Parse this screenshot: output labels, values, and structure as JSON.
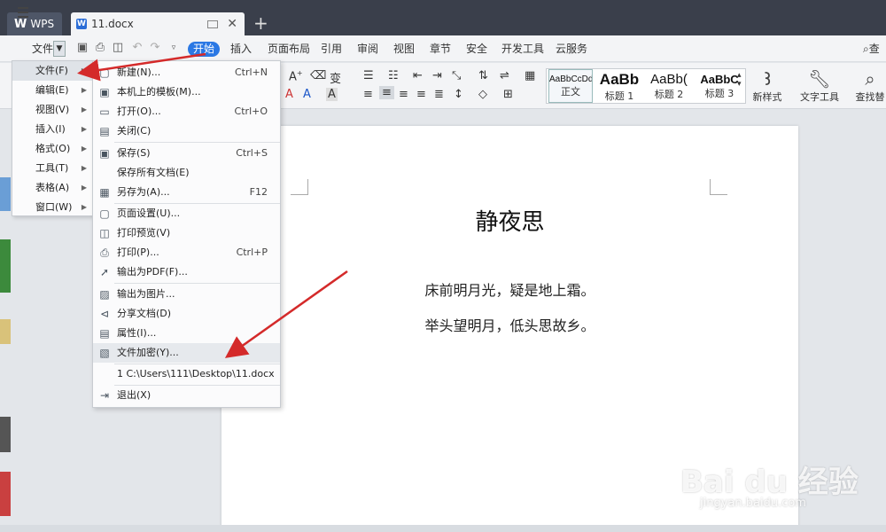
{
  "titlebar": {
    "app_tab": "WPS",
    "doc_tab": "11.docx",
    "new_tab_symbol": "+"
  },
  "menubar": {
    "file_label": "文件",
    "tabs": [
      "开始",
      "插入",
      "页面布局",
      "引用",
      "审阅",
      "视图",
      "章节",
      "安全",
      "开发工具",
      "云服务"
    ],
    "search_label": "查找"
  },
  "ribbon": {
    "styles": [
      {
        "preview": "AaBbCcDd",
        "name": "正文"
      },
      {
        "preview": "AaBb",
        "name": "标题 1"
      },
      {
        "preview": "AaBb(",
        "name": "标题 2"
      },
      {
        "preview": "AaBbC",
        "name": "标题 3"
      }
    ],
    "new_style": "新样式",
    "text_tools": "文字工具",
    "find_replace": "查找替"
  },
  "file_menu": {
    "items": [
      {
        "label": "文件(F)",
        "active": true
      },
      {
        "label": "编辑(E)"
      },
      {
        "label": "视图(V)"
      },
      {
        "label": "插入(I)"
      },
      {
        "label": "格式(O)"
      },
      {
        "label": "工具(T)"
      },
      {
        "label": "表格(A)"
      },
      {
        "label": "窗口(W)"
      }
    ]
  },
  "submenu": {
    "items": [
      {
        "icon": "new-doc-icon",
        "label": "新建(N)...",
        "shortcut": "Ctrl+N"
      },
      {
        "icon": "template-icon",
        "label": "本机上的模板(M)...",
        "shortcut": ""
      },
      {
        "icon": "open-folder-icon",
        "label": "打开(O)...",
        "shortcut": "Ctrl+O"
      },
      {
        "icon": "close-doc-icon",
        "label": "关闭(C)",
        "shortcut": ""
      },
      {
        "icon": "save-icon",
        "label": "保存(S)",
        "shortcut": "Ctrl+S"
      },
      {
        "icon": "",
        "label": "保存所有文档(E)",
        "shortcut": ""
      },
      {
        "icon": "save-as-icon",
        "label": "另存为(A)...",
        "shortcut": "F12"
      },
      {
        "icon": "page-setup-icon",
        "label": "页面设置(U)...",
        "shortcut": ""
      },
      {
        "icon": "print-preview-icon",
        "label": "打印预览(V)",
        "shortcut": ""
      },
      {
        "icon": "print-icon",
        "label": "打印(P)...",
        "shortcut": "Ctrl+P"
      },
      {
        "icon": "pdf-export-icon",
        "label": "输出为PDF(F)...",
        "shortcut": ""
      },
      {
        "icon": "image-export-icon",
        "label": "输出为图片...",
        "shortcut": ""
      },
      {
        "icon": "share-icon",
        "label": "分享文档(D)",
        "shortcut": ""
      },
      {
        "icon": "properties-icon",
        "label": "属性(I)...",
        "shortcut": ""
      },
      {
        "icon": "encrypt-icon",
        "label": "文件加密(Y)...",
        "shortcut": "",
        "highlight": true
      },
      {
        "icon": "",
        "label": "1 C:\\Users\\111\\Desktop\\11.docx",
        "shortcut": ""
      },
      {
        "icon": "exit-icon",
        "label": "退出(X)",
        "shortcut": ""
      }
    ]
  },
  "document": {
    "title": "静夜思",
    "lines": [
      "床前明月光，疑是地上霜。",
      "举头望明月，低头思故乡。"
    ]
  },
  "watermark": {
    "main": "Bai du 经验",
    "sub": "jingyan.baidu.com"
  },
  "colors": {
    "accent": "#2b78e4",
    "annotation_arrow": "#d42a2a",
    "titlebar": "#3a3f4b"
  }
}
